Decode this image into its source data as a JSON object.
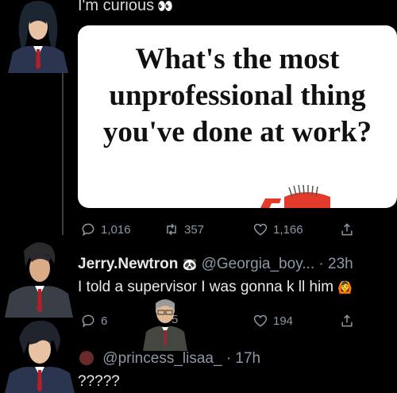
{
  "caption": {
    "text": "I'm curious",
    "emoji": "👀"
  },
  "question_card": {
    "line1": "What's the most",
    "line2": "unprofessional thing",
    "line3": "you've done at work?"
  },
  "tweet_actions": {
    "replies": "1,016",
    "retweets": "357",
    "likes": "1,166"
  },
  "reply1": {
    "name": "Jerry.Newtron",
    "badge": "🐼",
    "handle": "@Georgia_boy...",
    "time": "· 23h",
    "text": "I told a supervisor I was gonna k ll him",
    "emoji": "🙆",
    "replies": "6",
    "retweets": "5",
    "likes": "194"
  },
  "reply2": {
    "handle": "@princess_lisaa_",
    "time": "· 17h",
    "text": "?????"
  },
  "icons": [
    "reply-icon",
    "retweet-icon",
    "like-icon",
    "share-icon"
  ]
}
